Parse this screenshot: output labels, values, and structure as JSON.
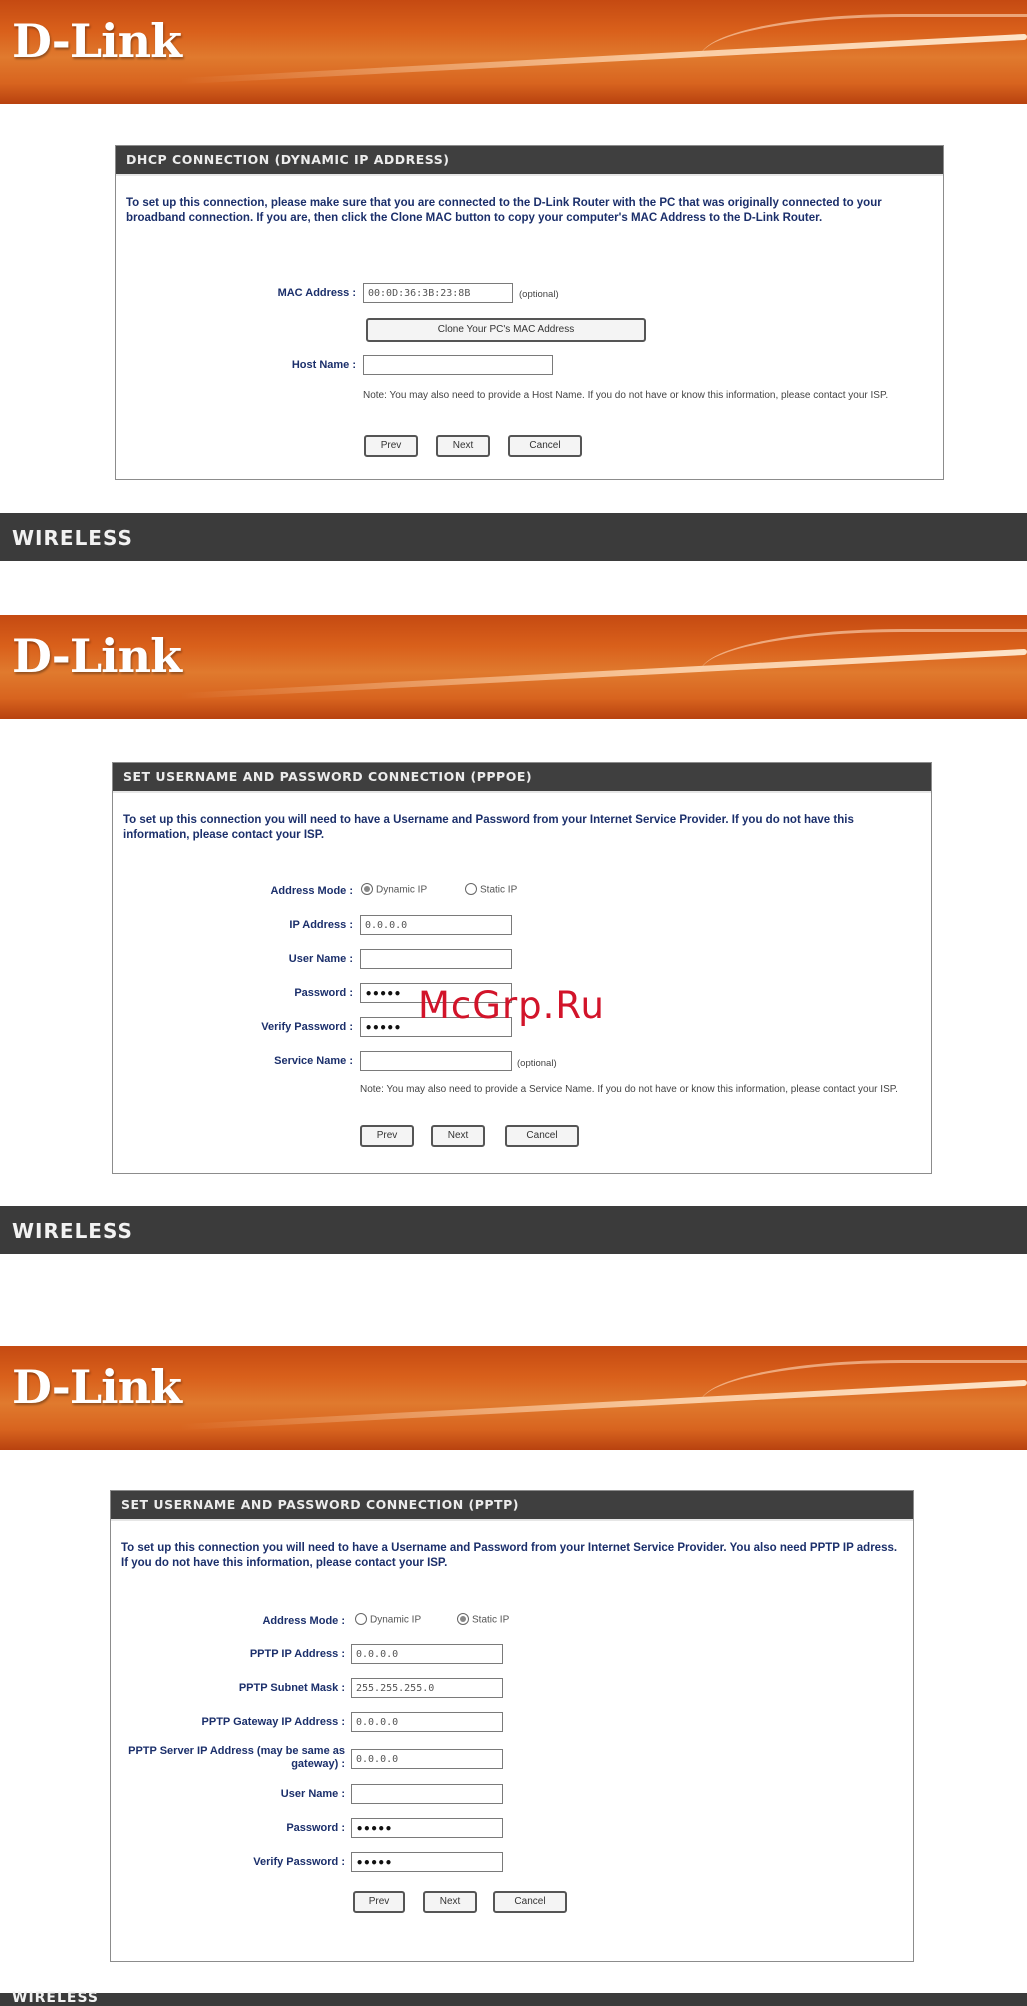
{
  "brand": {
    "logo_text": "D-Link",
    "wireless_label": "WIRELESS",
    "accent": "#d9601b",
    "bar_color": "#3b3b3b"
  },
  "watermark": "McGrp.Ru",
  "dhcp": {
    "title": "DHCP CONNECTION (DYNAMIC IP ADDRESS)",
    "intro": "To set up this connection, please make sure that you are connected to the D-Link Router with the PC that was originally connected to your broadband connection. If you are, then click the Clone MAC button to copy your computer's MAC Address to the D-Link Router.",
    "mac_label": "MAC Address :",
    "mac_value": "00:0D:36:3B:23:8B",
    "mac_hint": "(optional)",
    "clone_button": "Clone Your PC's MAC Address",
    "host_label": "Host Name :",
    "host_value": "",
    "note": "Note: You may also need to provide a Host Name. If you do not have or know this information, please contact your ISP.",
    "buttons": {
      "prev": "Prev",
      "next": "Next",
      "cancel": "Cancel"
    }
  },
  "pppoe": {
    "title": "SET USERNAME AND PASSWORD CONNECTION (PPPOE)",
    "intro": "To set up this connection you will need to have a Username and Password from your Internet Service Provider. If you do not have this information, please contact your ISP.",
    "address_mode_label": "Address Mode :",
    "dynamic_ip": "Dynamic IP",
    "static_ip": "Static IP",
    "selected_mode": "dynamic",
    "ip_label": "IP Address :",
    "ip_value": "0.0.0.0",
    "user_label": "User Name :",
    "user_value": "",
    "password_label": "Password :",
    "password_value": "•••••",
    "verify_label": "Verify Password :",
    "verify_value": "•••••",
    "service_label": "Service Name :",
    "service_value": "",
    "service_hint": "(optional)",
    "note": "Note: You may also need to provide a Service Name. If you do not have or know this information, please contact your ISP.",
    "buttons": {
      "prev": "Prev",
      "next": "Next",
      "cancel": "Cancel"
    }
  },
  "pptp": {
    "title": "SET USERNAME AND PASSWORD CONNECTION (PPTP)",
    "intro": "To set up this connection you will need to have a Username and Password from your Internet Service Provider. You also need PPTP IP adress. If you do not have this information, please contact your ISP.",
    "address_mode_label": "Address Mode :",
    "dynamic_ip": "Dynamic IP",
    "static_ip": "Static IP",
    "selected_mode": "static",
    "pptp_ip_label": "PPTP IP Address :",
    "pptp_ip_value": "0.0.0.0",
    "subnet_label": "PPTP Subnet Mask :",
    "subnet_value": "255.255.255.0",
    "gateway_label": "PPTP Gateway IP Address :",
    "gateway_value": "0.0.0.0",
    "server_label": "PPTP Server IP Address (may be same as gateway) :",
    "server_value": "0.0.0.0",
    "user_label": "User Name :",
    "user_value": "",
    "password_label": "Password :",
    "password_value": "•••••",
    "verify_label": "Verify Password :",
    "verify_value": "•••••",
    "buttons": {
      "prev": "Prev",
      "next": "Next",
      "cancel": "Cancel"
    }
  }
}
